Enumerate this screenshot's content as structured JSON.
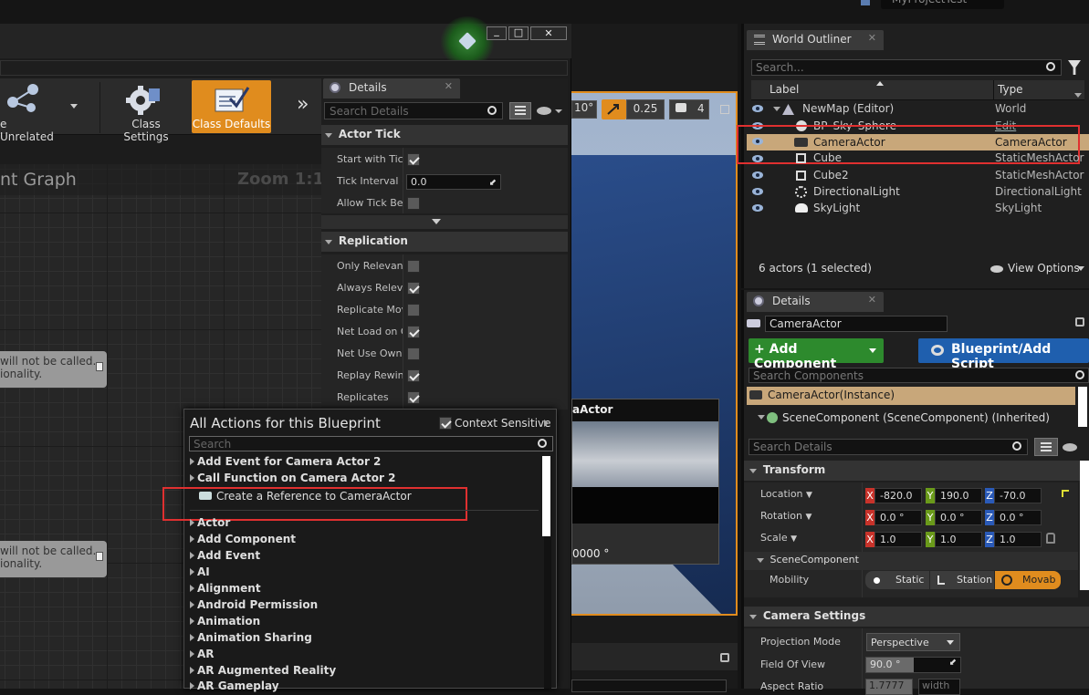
{
  "top_tab": {
    "project": "MyProjectTest"
  },
  "window_buttons": {
    "min": "_",
    "max": "□",
    "close": "✕"
  },
  "toolbar": {
    "hide_unrelated_label": "e Unrelated",
    "class_settings_label": "Class Settings",
    "class_defaults_label": "Class Defaults",
    "more_label": "»"
  },
  "graph": {
    "title": "nt Graph",
    "zoom": "Zoom 1:1",
    "node1_line1": "will not be called.",
    "node1_line2": "ionality.",
    "node2_line1": "will not be called.",
    "node2_line2": "ionality."
  },
  "bp_details": {
    "tab_label": "Details",
    "search_placeholder": "Search Details",
    "actor_tick": {
      "header": "Actor Tick",
      "start_with_tick": "Start with Tick",
      "tick_interval": "Tick Interval (s",
      "tick_interval_value": "0.0",
      "allow_tick": "Allow Tick Bef"
    },
    "replication": {
      "header": "Replication",
      "rows": [
        {
          "label": "Only Relevant",
          "checked": false
        },
        {
          "label": "Always Releva",
          "checked": true
        },
        {
          "label": "Replicate Mov",
          "checked": false
        },
        {
          "label": "Net Load on Cl",
          "checked": true
        },
        {
          "label": "Net Use Owne",
          "checked": false
        },
        {
          "label": "Replay Rewind",
          "checked": true
        },
        {
          "label": "Replicates",
          "checked": true
        }
      ]
    }
  },
  "viewport": {
    "angle": "10°",
    "scale_snap": "0.25",
    "camera_speed": "4",
    "preview_label": "aActor",
    "preview_value": "0000 °"
  },
  "actions_menu": {
    "title": "All Actions for this Blueprint",
    "context_sensitive": "Context Sensitive",
    "search_placeholder": "Search",
    "items": {
      "add_event_camera": "Add Event for Camera Actor 2",
      "call_function_camera": "Call Function on Camera Actor 2",
      "create_reference": "Create a Reference to CameraActor",
      "actor": "Actor",
      "add_component": "Add Component",
      "add_event": "Add Event",
      "ai": "AI",
      "alignment": "Alignment",
      "android_permission": "Android Permission",
      "animation": "Animation",
      "animation_sharing": "Animation Sharing",
      "ar": "AR",
      "ar_augmented": "AR Augmented Reality",
      "ar_gameplay": "AR Gameplay"
    }
  },
  "world_outliner": {
    "tab_label": "World Outliner",
    "search_placeholder": "Search...",
    "col_label": "Label",
    "col_type": "Type",
    "rows": [
      {
        "label": "NewMap (Editor)",
        "type": "World"
      },
      {
        "label": "BP_Sky_Sphere",
        "type": "Edit BP_Sky_Sphe"
      },
      {
        "label": "CameraActor",
        "type": "CameraActor"
      },
      {
        "label": "Cube",
        "type": "StaticMeshActor"
      },
      {
        "label": "Cube2",
        "type": "StaticMeshActor"
      },
      {
        "label": "DirectionalLight",
        "type": "DirectionalLight"
      },
      {
        "label": "SkyLight",
        "type": "SkyLight"
      }
    ],
    "status": "6 actors (1 selected)",
    "view_options": "View Options"
  },
  "level_details": {
    "tab_label": "Details",
    "actor_name": "CameraActor",
    "add_component": "+ Add Component",
    "blueprint_script": "Blueprint/Add Script",
    "search_components": "Search Components",
    "instance_label": "CameraActor(Instance)",
    "scene_component_label": "SceneComponent (SceneComponent) (Inherited)",
    "search_details": "Search Details",
    "transform_header": "Transform",
    "location": {
      "label": "Location",
      "x": "-820.0",
      "y": "190.0",
      "z": "-70.0"
    },
    "rotation": {
      "label": "Rotation",
      "x": "0.0 °",
      "y": "0.0 °",
      "z": "0.0 °"
    },
    "scale": {
      "label": "Scale",
      "x": "1.0",
      "y": "1.0",
      "z": "1.0"
    },
    "scene_comp_sub": "SceneComponent",
    "mobility": {
      "label": "Mobility",
      "static": "Static",
      "stationary": "Station",
      "movable": "Movab"
    },
    "camera_settings_header": "Camera Settings",
    "projection_mode": {
      "label": "Projection Mode",
      "value": "Perspective"
    },
    "fov": {
      "label": "Field Of View",
      "value": "90.0 °"
    },
    "aspect": {
      "label": "Aspect Ratio",
      "value": "1.7777",
      "width": "width"
    }
  },
  "colors": {
    "accent_orange": "#e08c1e",
    "selection_red": "#e03030",
    "add_green": "#2d8a2d",
    "blueprint_blue": "#1f5fae"
  }
}
